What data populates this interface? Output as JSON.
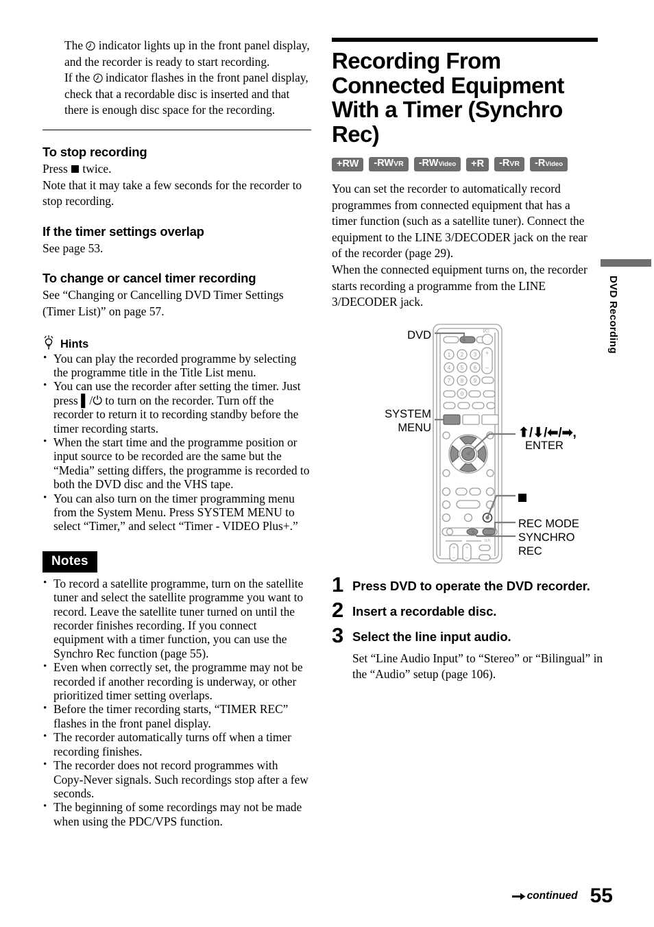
{
  "left_column": {
    "intro": {
      "para1_pre": "The ",
      "para1_icon": "timer-clock-icon",
      "para1_post": " indicator lights up in the front panel display, and the recorder is ready to start recording.",
      "para2_pre": "If the ",
      "para2_icon": "timer-clock-icon",
      "para2_post": " indicator flashes in the front panel display, check that a recordable disc is inserted and that there is enough disc space for the recording."
    },
    "sections": [
      {
        "heading": "To stop recording",
        "body_pre": "Press ",
        "body_icon": "stop-square-icon",
        "body_post": " twice.",
        "body_line2": "Note that it may take a few seconds for the recorder to stop recording."
      },
      {
        "heading": "If the timer settings overlap",
        "body": "See page 53."
      },
      {
        "heading": "To change or cancel timer recording",
        "body": "See “Changing or Cancelling DVD Timer Settings (Timer List)”  on page 57."
      }
    ],
    "hints": {
      "icon": "lightbulb-icon",
      "label": "Hints",
      "items": [
        "You can play the recorded programme by selecting the programme title in the Title List menu.",
        "You can use the recorder after setting the timer. Just press ▌/⏻ to turn on the recorder. Turn off the recorder to return it to recording standby before the timer recording starts.",
        "When the start time and the programme position or input source to be recorded are the same but the “Media” setting differs, the programme is recorded to both the DVD disc and the VHS tape.",
        "You can also turn on the timer programming menu from the System Menu. Press SYSTEM MENU to select “Timer,” and select “Timer - VIDEO Plus+.”"
      ]
    },
    "notes": {
      "label": "Notes",
      "items": [
        "To record a satellite programme, turn on the satellite tuner and select the satellite programme you want to record. Leave the satellite tuner turned on until the recorder finishes recording. If you connect equipment with a timer function, you can use the Synchro Rec function (page 55).",
        "Even when correctly set, the programme may not be recorded if another recording is underway, or other prioritized timer setting overlaps.",
        "Before the timer recording starts, “TIMER REC” flashes in the front panel display.",
        "The recorder automatically turns off when a timer recording finishes.",
        "The recorder does not record programmes with Copy-Never signals. Such recordings stop after a few seconds.",
        "The beginning of some recordings may not be made when using the PDC/VPS function."
      ]
    }
  },
  "right_column": {
    "title": "Recording From Connected Equipment With a Timer (Synchro Rec)",
    "badges": [
      {
        "main": "+RW",
        "sub": "",
        "sub_style": ""
      },
      {
        "main": "-RW",
        "sub": "VR",
        "sub_style": "sub"
      },
      {
        "main": "-RW",
        "sub": "Video",
        "sub_style": "sub-sm"
      },
      {
        "main": "+R",
        "sub": "",
        "sub_style": ""
      },
      {
        "main": "-R",
        "sub": "VR",
        "sub_style": "sub"
      },
      {
        "main": "-R",
        "sub": "Video",
        "sub_style": "sub-sm"
      }
    ],
    "body_para1": "You can set the recorder to automatically record programmes from connected equipment that has a timer function (such as a satellite tuner). Connect the equipment to the LINE 3/DECODER jack on the rear of the recorder (page 29).",
    "body_para2": "When the connected equipment turns on, the recorder starts recording a programme from the LINE 3/DECODER jack."
  },
  "remote_diagram": {
    "callouts": {
      "dvd": "DVD",
      "system_menu_line1": "SYSTEM",
      "system_menu_line2": "MENU",
      "arrows_enter_line1": "⬆/⬇/⬅/➡,",
      "arrows_enter_line2": "ENTER",
      "stop_icon": "stop-square-icon",
      "rec_mode": "REC MODE",
      "synchro_line1": "SYNCHRO",
      "synchro_line2": "REC"
    },
    "keypad": [
      "1",
      "2",
      "3",
      "4",
      "5",
      "6",
      "7",
      "8",
      "9",
      "0"
    ],
    "power_label": "▌/⏻",
    "volume_plus": "+",
    "volume_minus": "–",
    "colors": {
      "highlight": "#8c8c8c",
      "outline": "#9a9a9a",
      "callout_line": "#808080"
    }
  },
  "steps": [
    {
      "num": "1",
      "text": "Press DVD to operate the DVD recorder."
    },
    {
      "num": "2",
      "text": "Insert a recordable disc."
    },
    {
      "num": "3",
      "text": "Select the line input audio.",
      "sub": "Set “Line Audio Input” to “Stereo” or “Bilingual” in the “Audio” setup (page 106)."
    }
  ],
  "side_tab": {
    "label": "DVD Recording",
    "bar_color": "#6e6e6e"
  },
  "footer": {
    "continued": "continued",
    "page_number": "55"
  }
}
